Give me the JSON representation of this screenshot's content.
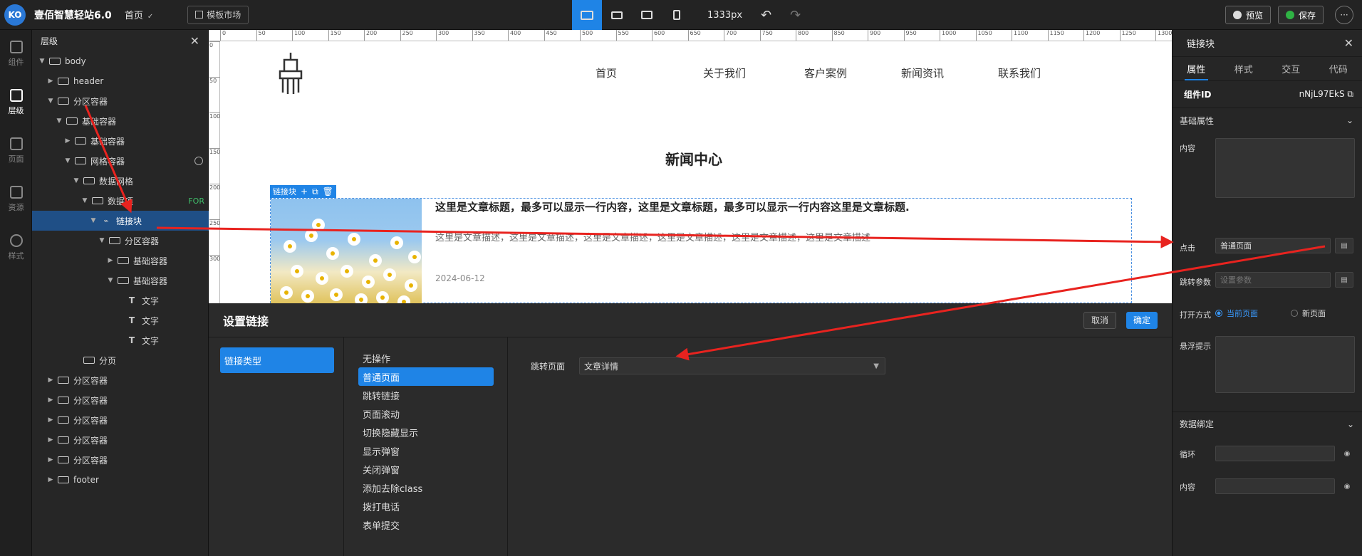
{
  "app": {
    "logo_text": "KO",
    "name": "壹佰智慧轻站6.0",
    "page": "首页",
    "template_market": "模板市场",
    "viewport": "1333px",
    "preview": "预览",
    "save": "保存",
    "more": "···"
  },
  "rail": [
    {
      "label": "组件",
      "icon": "grid-icon"
    },
    {
      "label": "层级",
      "icon": "layers-icon"
    },
    {
      "label": "页面",
      "icon": "page-icon"
    },
    {
      "label": "资源",
      "icon": "image-icon"
    },
    {
      "label": "样式",
      "icon": "brush-icon"
    }
  ],
  "layers": {
    "title": "层级",
    "rows": [
      {
        "label": "body",
        "depth": 0,
        "arrow": "▼",
        "type": "box"
      },
      {
        "label": "header",
        "depth": 1,
        "arrow": "▶",
        "type": "box"
      },
      {
        "label": "分区容器",
        "depth": 1,
        "arrow": "▼",
        "type": "section"
      },
      {
        "label": "基础容器",
        "depth": 2,
        "arrow": "▼",
        "type": "col"
      },
      {
        "label": "基础容器",
        "depth": 3,
        "arrow": "▶",
        "type": "col"
      },
      {
        "label": "网格容器",
        "depth": 3,
        "arrow": "▼",
        "type": "grid",
        "extra": "clock"
      },
      {
        "label": "数据网格",
        "depth": 4,
        "arrow": "▼",
        "type": "data"
      },
      {
        "label": "数据项",
        "depth": 5,
        "arrow": "▼",
        "type": "box",
        "badge": "FOR"
      },
      {
        "label": "链接块",
        "depth": 6,
        "arrow": "▼",
        "type": "link",
        "selected": true
      },
      {
        "label": "分区容器",
        "depth": 7,
        "arrow": "▼",
        "type": "section"
      },
      {
        "label": "基础容器",
        "depth": 8,
        "arrow": "▶",
        "type": "col"
      },
      {
        "label": "基础容器",
        "depth": 8,
        "arrow": "▼",
        "type": "col"
      },
      {
        "label": "文字",
        "depth": 9,
        "arrow": "",
        "type": "text"
      },
      {
        "label": "文字",
        "depth": 9,
        "arrow": "",
        "type": "text"
      },
      {
        "label": "文字",
        "depth": 9,
        "arrow": "",
        "type": "text"
      },
      {
        "label": "分页",
        "depth": 4,
        "arrow": "",
        "type": "box"
      },
      {
        "label": "分区容器",
        "depth": 1,
        "arrow": "▶",
        "type": "section"
      },
      {
        "label": "分区容器",
        "depth": 1,
        "arrow": "▶",
        "type": "section"
      },
      {
        "label": "分区容器",
        "depth": 1,
        "arrow": "▶",
        "type": "section"
      },
      {
        "label": "分区容器",
        "depth": 1,
        "arrow": "▶",
        "type": "section"
      },
      {
        "label": "分区容器",
        "depth": 1,
        "arrow": "▶",
        "type": "section"
      },
      {
        "label": "footer",
        "depth": 1,
        "arrow": "▶",
        "type": "box"
      }
    ]
  },
  "ruler_ticks": [
    "0",
    "50",
    "100",
    "150",
    "200",
    "250",
    "300",
    "350",
    "400",
    "450",
    "500",
    "550",
    "600",
    "650",
    "700",
    "750",
    "800",
    "850",
    "900",
    "950",
    "1000",
    "1050",
    "1100",
    "1150",
    "1200",
    "1250",
    "1300"
  ],
  "vruler_ticks": [
    "0",
    "50",
    "100",
    "150",
    "200",
    "250",
    "300"
  ],
  "site": {
    "nav": [
      "首页",
      "关于我们",
      "客户案例",
      "新闻资讯",
      "联系我们"
    ],
    "section_title": "新闻中心",
    "linkblock_tag": "链接块",
    "article_title": "这里是文章标题，最多可以显示一行内容，这里是文章标题，最多可以显示一行内容这里是文章标题.",
    "article_desc": "这里是文章描述，这里是文章描述，这里是文章描述，这里是文章描述，这里是文章描述，这里是文章描述",
    "article_date": "2024-06-12"
  },
  "dialog": {
    "title": "设置链接",
    "cancel": "取消",
    "ok": "确定",
    "link_type": "链接类型",
    "options": [
      "无操作",
      "普通页面",
      "跳转链接",
      "页面滚动",
      "切换隐藏显示",
      "显示弹窗",
      "关闭弹窗",
      "添加去除class",
      "拨打电话",
      "表单提交"
    ],
    "selected_option": "普通页面",
    "jump_label": "跳转页面",
    "jump_value": "文章详情"
  },
  "props": {
    "title": "链接块",
    "tabs": [
      "属性",
      "样式",
      "交互",
      "代码"
    ],
    "comp_id_label": "组件ID",
    "comp_id_value": "nNjL97EkS",
    "basic": "基础属性",
    "content_label": "内容",
    "click_label": "点击",
    "click_value": "普通页面",
    "param_label": "跳转参数",
    "param_placeholder": "设置参数",
    "open_label": "打开方式",
    "open_current": "当前页面",
    "open_new": "新页面",
    "tooltip_label": "悬浮提示",
    "binding": "数据绑定",
    "loop_label": "循环",
    "content2_label": "内容"
  },
  "colors": {
    "accent": "#1f84e6",
    "arrow": "#e8231f",
    "save": "#2fb344"
  }
}
